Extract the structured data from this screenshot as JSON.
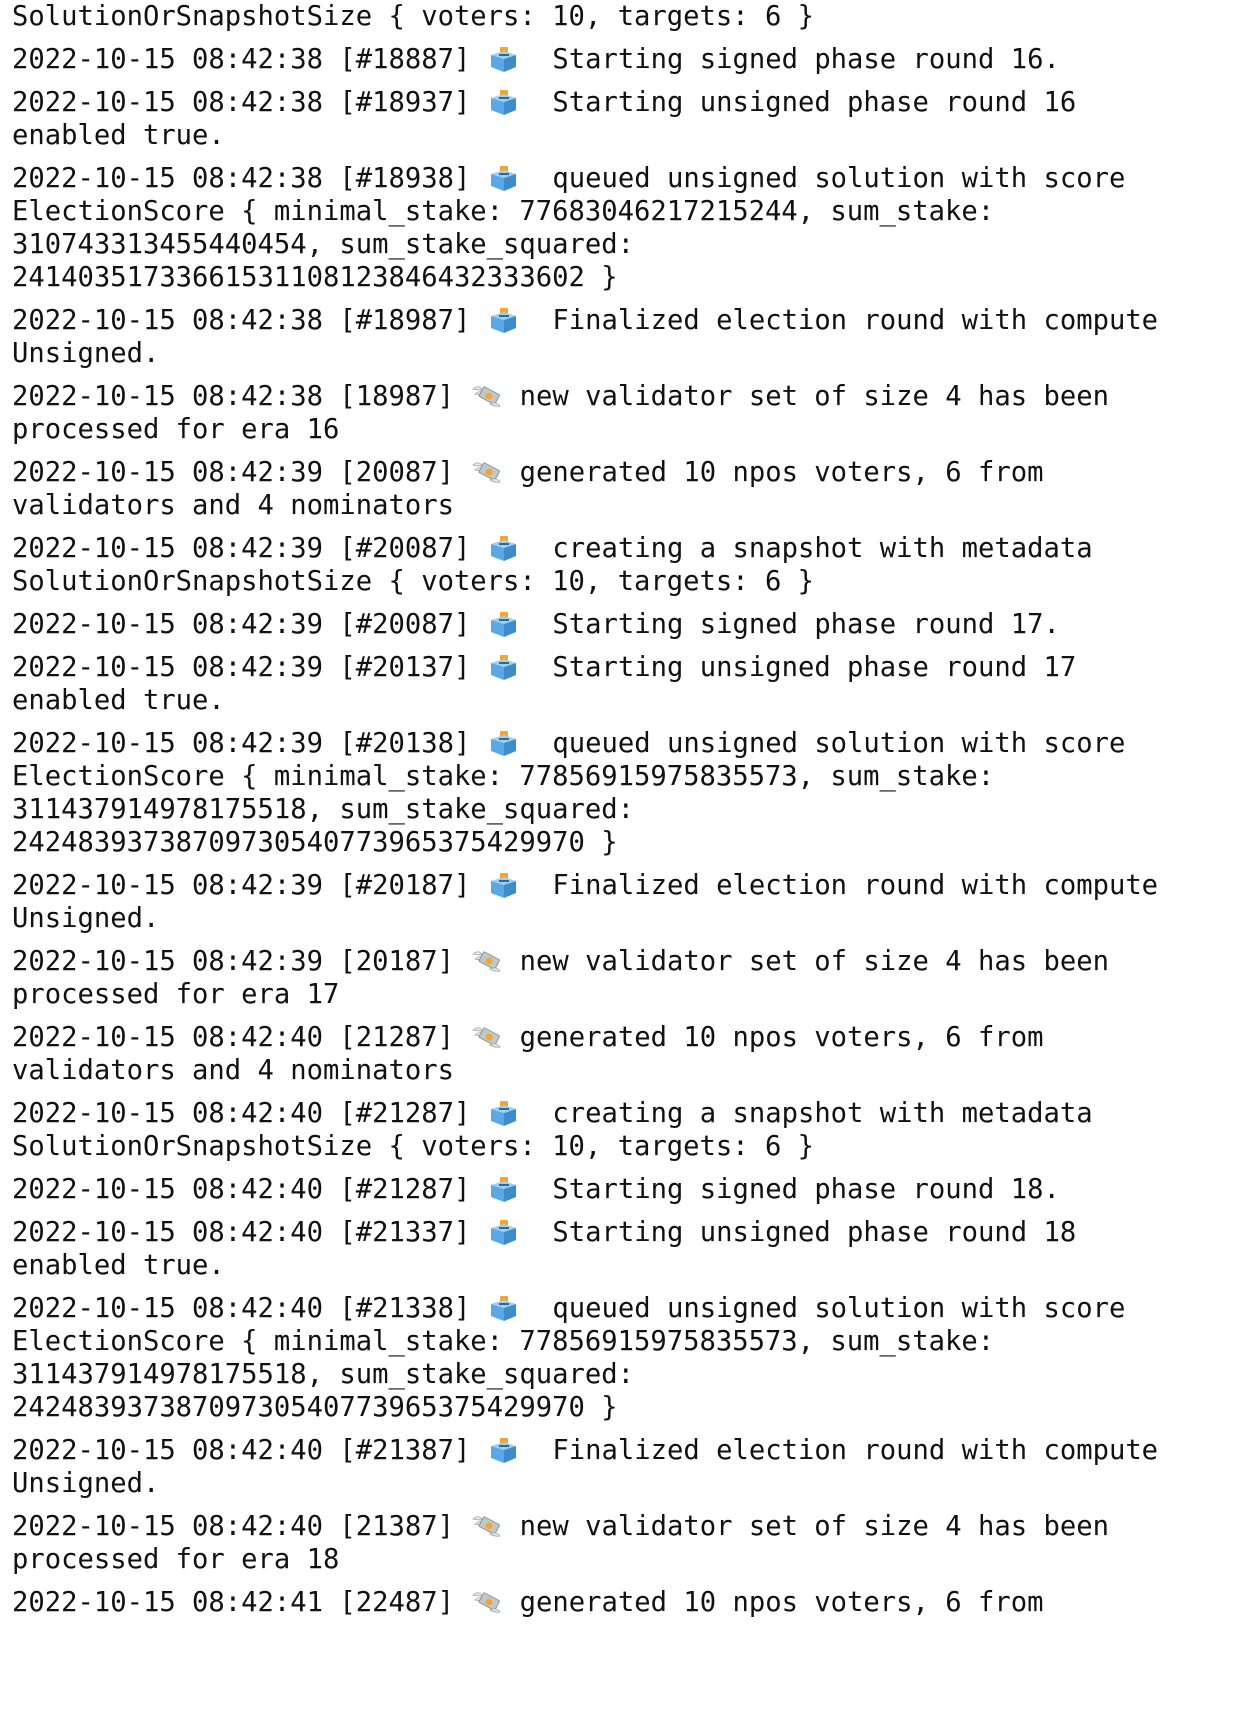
{
  "icons": {
    "ballot": "ballot-box-icon",
    "money": "money-with-wings-icon"
  },
  "colors": {
    "background": "#ffffff",
    "text": "#111111",
    "ballot_box": "#5aa9e6",
    "ballot_paper": "#f4a430",
    "money_note": "#bfc8c6"
  },
  "lines": [
    {
      "parts": [
        "SolutionOrSnapshotSize { voters: 10, targets: 6 }"
      ]
    },
    {
      "parts": [
        "2022-10-15 08:42:38 [#18887] ",
        "@ballot",
        "  Starting signed phase round 16."
      ]
    },
    {
      "parts": [
        "2022-10-15 08:42:38 [#18937] ",
        "@ballot",
        "  Starting unsigned phase round 16"
      ]
    },
    {
      "parts": [
        "enabled true."
      ]
    },
    {
      "parts": [
        "2022-10-15 08:42:38 [#18938] ",
        "@ballot",
        "  queued unsigned solution with score"
      ]
    },
    {
      "parts": [
        "ElectionScore { minimal_stake: 77683046217215244, sum_stake:"
      ]
    },
    {
      "parts": [
        "310743313455440454, sum_stake_squared:"
      ]
    },
    {
      "parts": [
        "24140351733661531108123846432333602 }"
      ]
    },
    {
      "parts": [
        "2022-10-15 08:42:38 [#18987] ",
        "@ballot",
        "  Finalized election round with compute"
      ]
    },
    {
      "parts": [
        "Unsigned."
      ]
    },
    {
      "parts": [
        "2022-10-15 08:42:38 [18987] ",
        "@money",
        " new validator set of size 4 has been"
      ]
    },
    {
      "parts": [
        "processed for era 16"
      ]
    },
    {
      "parts": [
        "2022-10-15 08:42:39 [20087] ",
        "@money",
        " generated 10 npos voters, 6 from"
      ]
    },
    {
      "parts": [
        "validators and 4 nominators"
      ]
    },
    {
      "parts": [
        "2022-10-15 08:42:39 [#20087] ",
        "@ballot",
        "  creating a snapshot with metadata"
      ]
    },
    {
      "parts": [
        "SolutionOrSnapshotSize { voters: 10, targets: 6 }"
      ]
    },
    {
      "parts": [
        "2022-10-15 08:42:39 [#20087] ",
        "@ballot",
        "  Starting signed phase round 17."
      ]
    },
    {
      "parts": [
        "2022-10-15 08:42:39 [#20137] ",
        "@ballot",
        "  Starting unsigned phase round 17"
      ]
    },
    {
      "parts": [
        "enabled true."
      ]
    },
    {
      "parts": [
        "2022-10-15 08:42:39 [#20138] ",
        "@ballot",
        "  queued unsigned solution with score"
      ]
    },
    {
      "parts": [
        "ElectionScore { minimal_stake: 77856915975835573, sum_stake:"
      ]
    },
    {
      "parts": [
        "311437914978175518, sum_stake_squared:"
      ]
    },
    {
      "parts": [
        "24248393738709730540773965375429970 }"
      ]
    },
    {
      "parts": [
        "2022-10-15 08:42:39 [#20187] ",
        "@ballot",
        "  Finalized election round with compute"
      ]
    },
    {
      "parts": [
        "Unsigned."
      ]
    },
    {
      "parts": [
        "2022-10-15 08:42:39 [20187] ",
        "@money",
        " new validator set of size 4 has been"
      ]
    },
    {
      "parts": [
        "processed for era 17"
      ]
    },
    {
      "parts": [
        "2022-10-15 08:42:40 [21287] ",
        "@money",
        " generated 10 npos voters, 6 from"
      ]
    },
    {
      "parts": [
        "validators and 4 nominators"
      ]
    },
    {
      "parts": [
        "2022-10-15 08:42:40 [#21287] ",
        "@ballot",
        "  creating a snapshot with metadata"
      ]
    },
    {
      "parts": [
        "SolutionOrSnapshotSize { voters: 10, targets: 6 }"
      ]
    },
    {
      "parts": [
        "2022-10-15 08:42:40 [#21287] ",
        "@ballot",
        "  Starting signed phase round 18."
      ]
    },
    {
      "parts": [
        "2022-10-15 08:42:40 [#21337] ",
        "@ballot",
        "  Starting unsigned phase round 18"
      ]
    },
    {
      "parts": [
        "enabled true."
      ]
    },
    {
      "parts": [
        "2022-10-15 08:42:40 [#21338] ",
        "@ballot",
        "  queued unsigned solution with score"
      ]
    },
    {
      "parts": [
        "ElectionScore { minimal_stake: 77856915975835573, sum_stake:"
      ]
    },
    {
      "parts": [
        "311437914978175518, sum_stake_squared:"
      ]
    },
    {
      "parts": [
        "24248393738709730540773965375429970 }"
      ]
    },
    {
      "parts": [
        "2022-10-15 08:42:40 [#21387] ",
        "@ballot",
        "  Finalized election round with compute"
      ]
    },
    {
      "parts": [
        "Unsigned."
      ]
    },
    {
      "parts": [
        "2022-10-15 08:42:40 [21387] ",
        "@money",
        " new validator set of size 4 has been"
      ]
    },
    {
      "parts": [
        "processed for era 18"
      ]
    },
    {
      "parts": [
        "2022-10-15 08:42:41 [22487] ",
        "@money",
        " generated 10 npos voters, 6 from"
      ]
    }
  ]
}
